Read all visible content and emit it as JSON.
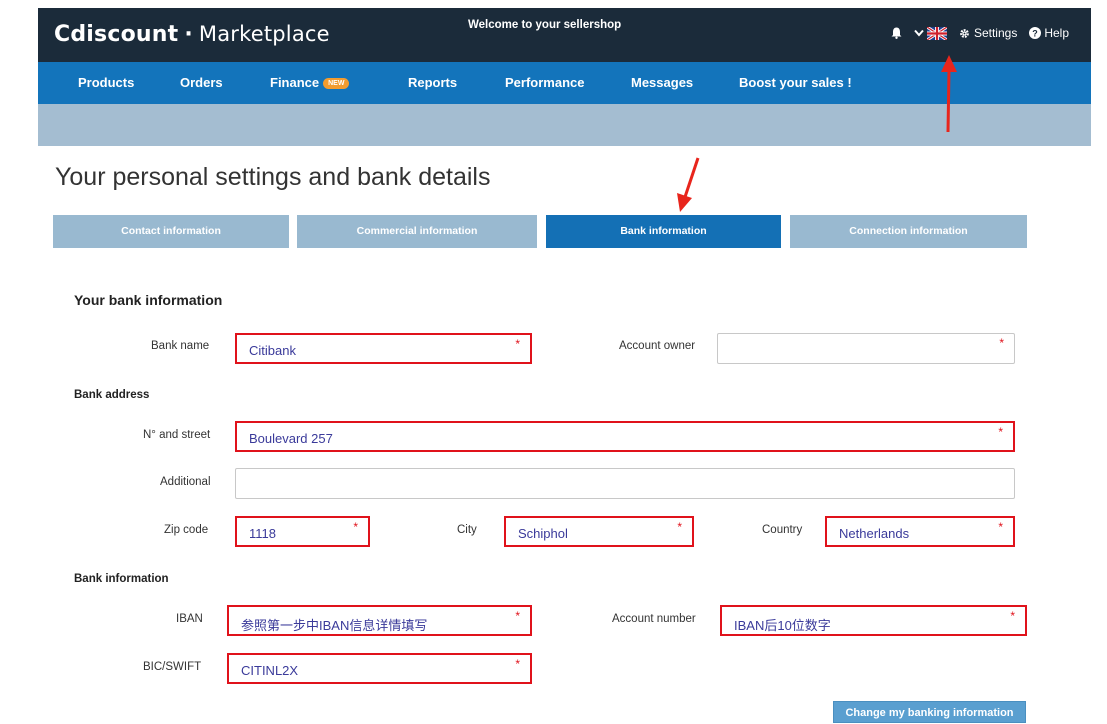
{
  "header": {
    "logo_main": "Cdiscount",
    "logo_sep": "·",
    "logo_sub": "Marketplace",
    "welcome": "Welcome to your sellershop",
    "settings": "Settings",
    "help": "Help"
  },
  "nav": {
    "items": [
      "Products",
      "Orders",
      "Finance",
      "Reports",
      "Performance",
      "Messages",
      "Boost your sales !"
    ],
    "new_badge": "NEW"
  },
  "page": {
    "title": "Your personal settings and bank details"
  },
  "tabs": [
    "Contact information",
    "Commercial information",
    "Bank information",
    "Connection information"
  ],
  "form": {
    "section_title": "Your bank information",
    "bank_address_title": "Bank address",
    "bank_info_title": "Bank information",
    "bank_name": {
      "label": "Bank name",
      "value": "Citibank"
    },
    "account_owner": {
      "label": "Account owner",
      "value": ""
    },
    "street": {
      "label": "N° and street",
      "value": "Boulevard 257"
    },
    "additional": {
      "label": "Additional",
      "value": ""
    },
    "zip": {
      "label": "Zip code",
      "value": "1118"
    },
    "city": {
      "label": "City",
      "value": "Schiphol"
    },
    "country": {
      "label": "Country",
      "value": "Netherlands"
    },
    "iban": {
      "label": "IBAN",
      "value": "参照第一步中IBAN信息详情填写"
    },
    "account_number": {
      "label": "Account number",
      "value": "IBAN后10位数字"
    },
    "bic": {
      "label": "BIC/SWIFT",
      "value": "CITINL2X"
    },
    "required_mark": "*",
    "submit": "Change my banking information"
  },
  "colors": {
    "topbar": "#1b2b3a",
    "nav": "#1374bb",
    "subbar": "#a4bdd1",
    "active_tab": "#1470b5",
    "highlight": "#e0121b"
  }
}
